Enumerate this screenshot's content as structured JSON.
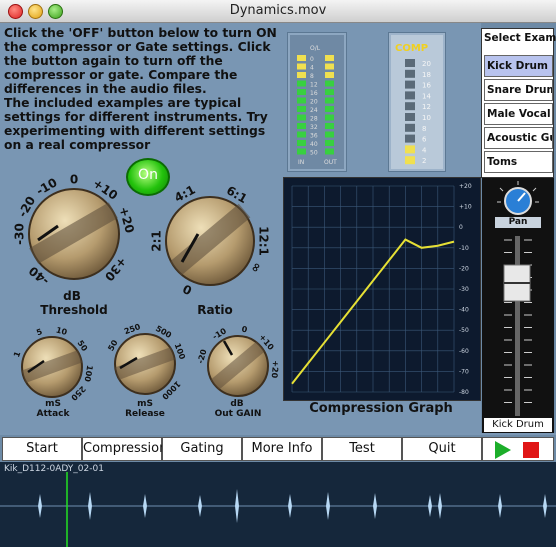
{
  "window": {
    "title": "Dynamics.mov"
  },
  "intro": {
    "p1": "Click the 'OFF' button below to turn ON the compressor or Gate settings. Click the button again to turn off the compressor or gate. Compare the differences in the audio files.",
    "p2": "The included examples are typical settings for different instruments. Try experimenting with different settings on a real compressor"
  },
  "io_meter": {
    "top_label": "O/L",
    "scale": [
      "0",
      "4",
      "8",
      "12",
      "16",
      "20",
      "24",
      "28",
      "32",
      "36",
      "40",
      "50"
    ],
    "in_label": "IN",
    "out_label": "OUT"
  },
  "comp_meter": {
    "label": "COMP",
    "scale": [
      "20",
      "18",
      "16",
      "14",
      "12",
      "10",
      "8",
      "6",
      "4",
      "2"
    ]
  },
  "on_button": {
    "label": "On"
  },
  "knobs": {
    "threshold": {
      "ticks": [
        "-10",
        "0",
        "+10",
        "-20",
        "+20",
        "-30",
        "-40",
        "+30"
      ],
      "unit": "dB",
      "name": "Threshold"
    },
    "ratio": {
      "ticks": [
        "4:1",
        "6:1",
        "2:1",
        "12:1",
        "0",
        "∞"
      ],
      "name": "Ratio"
    },
    "attack": {
      "ticks": [
        "5",
        "10",
        "50",
        "1",
        "100",
        "250"
      ],
      "unit": "mS",
      "name": "Attack"
    },
    "release": {
      "ticks": [
        "250",
        "500",
        "100",
        "50",
        "1000"
      ],
      "unit": "mS",
      "name": "Release"
    },
    "out_gain": {
      "ticks": [
        "-10",
        "0",
        "+10",
        "-20",
        "+20"
      ],
      "unit": "dB",
      "name": "Out GAIN"
    }
  },
  "graph": {
    "title": "Compression Graph",
    "yticks": [
      "+20",
      "+10",
      "0",
      "-10",
      "-20",
      "-30",
      "-40",
      "-50",
      "-60",
      "-70",
      "-80"
    ]
  },
  "chart_data": {
    "type": "line",
    "title": "Compression Graph",
    "xlabel": "",
    "ylabel": "",
    "ylim": [
      -80,
      20
    ],
    "grid": true,
    "series": [
      {
        "x": [
          -80,
          -70,
          -60,
          -50,
          -40,
          -30,
          -20,
          -10,
          0,
          10,
          20
        ],
        "values": [
          -76,
          -66,
          -56,
          -46,
          -36,
          -26,
          -16,
          -6,
          -10,
          -9,
          -7
        ]
      }
    ]
  },
  "examples": {
    "header": "Select Example",
    "items": [
      "Kick Drum",
      "Snare Drum",
      "Male Vocal",
      "Acoustic Guitar",
      "Toms"
    ],
    "selected_index": 0
  },
  "mixer": {
    "pan_label": "Pan",
    "channel_label": "Kick Drum"
  },
  "tabs": [
    "Start",
    "Compression",
    "Gating",
    "More Info",
    "Test",
    "Quit"
  ],
  "transport": {
    "play": "play-icon",
    "stop": "stop-icon"
  },
  "waveform": {
    "file_label": "Kik_D112-0ADY_02-01"
  },
  "colors": {
    "panel": "#7996b3",
    "graph_line": "#e6e035",
    "meter_green": "#38d040",
    "meter_yellow": "#f0e050",
    "selected_item": "#b8c3ee",
    "play": "#1cae2a",
    "stop": "#e01616"
  }
}
